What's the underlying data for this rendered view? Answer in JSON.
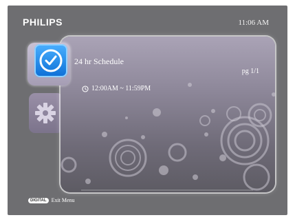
{
  "header": {
    "brand": "PHILIPS",
    "time": "11:06 AM"
  },
  "menu": {
    "tabs": [
      {
        "name": "schedule",
        "icon": "clock-icon",
        "selected": true
      },
      {
        "name": "settings",
        "icon": "gear-icon",
        "selected": false
      }
    ]
  },
  "panel": {
    "title": "24 hr Schedule",
    "page_indicator": "pg 1/1",
    "entries": [
      {
        "icon": "clock-icon",
        "range": "12:00AM ~ 11:59PM"
      }
    ]
  },
  "footer": {
    "key_label": "DIGITAL",
    "action_label": "Exit Menu"
  },
  "colors": {
    "background": "#6e6e71",
    "panel_top": "#aaa3b6",
    "panel_bottom": "#5d5b63",
    "accent_blue": "#1a84e6"
  }
}
